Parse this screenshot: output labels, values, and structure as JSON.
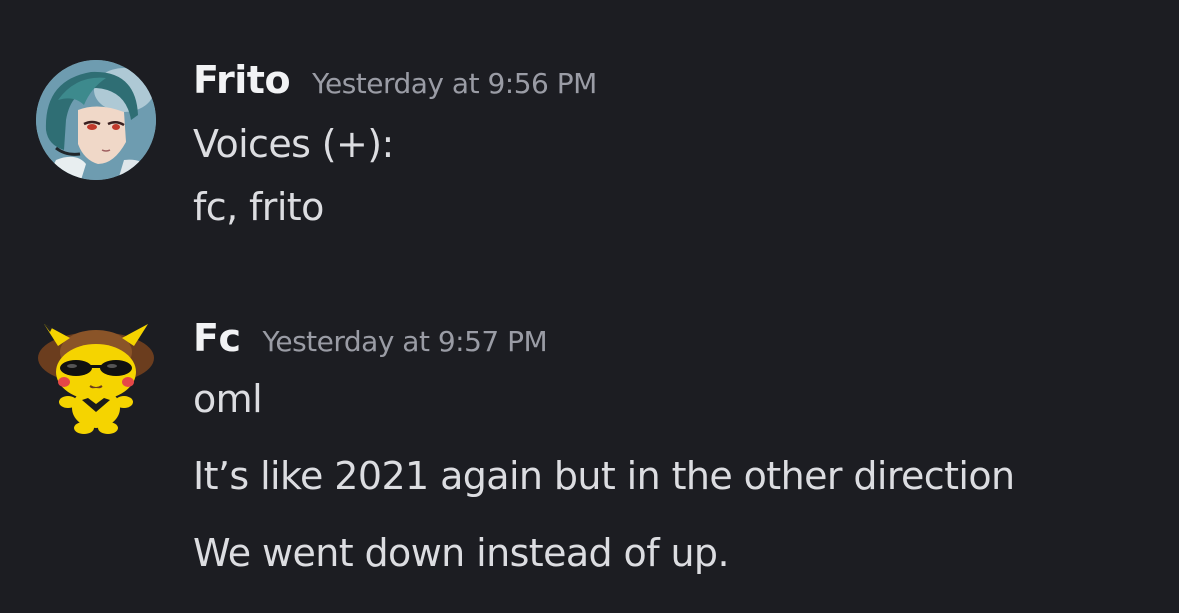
{
  "messages": [
    {
      "author": "Frito",
      "timestamp": "Yesterday at 9:56 PM",
      "avatar_icon": "anime-character-avatar",
      "lines": [
        "Voices (+):",
        "fc, frito"
      ]
    },
    {
      "author": "Fc",
      "timestamp": "Yesterday at 9:57 PM",
      "avatar_icon": "pikachu-sunglasses-avatar",
      "lines": [
        "oml",
        "It’s like 2021 again but in the other direction",
        "We went down instead of up."
      ]
    }
  ],
  "colors": {
    "background": "#1c1d22",
    "author": "#f2f3f5",
    "timestamp": "#9a9ca5",
    "text": "#dcdde1"
  }
}
